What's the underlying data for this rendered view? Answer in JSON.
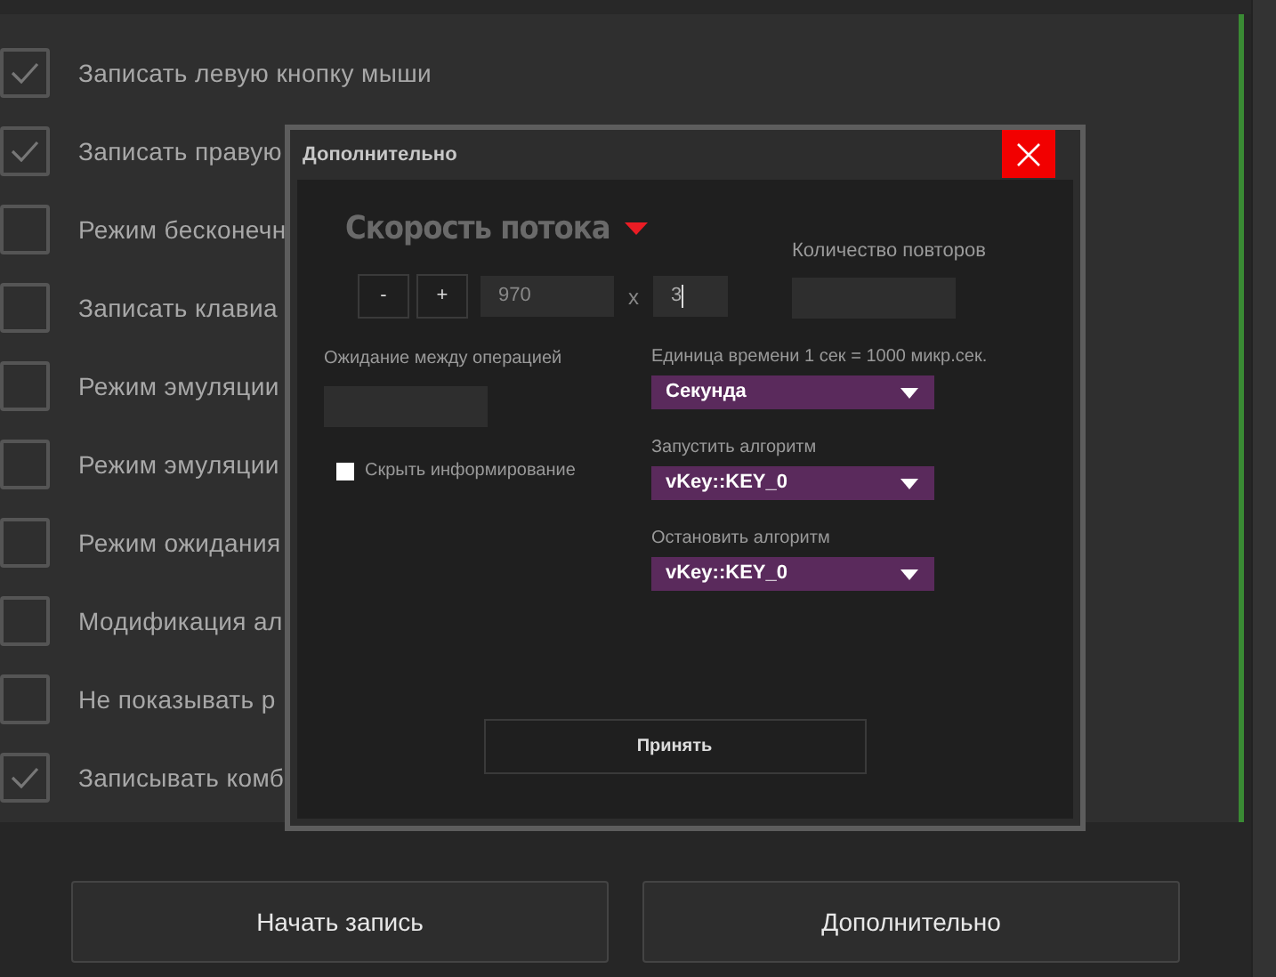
{
  "options": [
    {
      "label": "Записать левую кнопку мыши",
      "checked": true
    },
    {
      "label": "Записать правую",
      "checked": true
    },
    {
      "label": "Режим бесконечн",
      "checked": false
    },
    {
      "label": "Записать клавиа",
      "checked": false
    },
    {
      "label": "Режим эмуляции",
      "checked": false
    },
    {
      "label": "Режим эмуляции",
      "checked": false
    },
    {
      "label": "Режим ожидания",
      "checked": false
    },
    {
      "label": "Модификация ал",
      "checked": false
    },
    {
      "label": "Не показывать р",
      "checked": false
    },
    {
      "label": "Записывать комб",
      "checked": true
    }
  ],
  "buttons": [
    "Начать запись",
    "Дополнительно"
  ],
  "dialog": {
    "title": "Дополнительно",
    "speed_title": "Скорость потока",
    "minus": "-",
    "plus": "+",
    "speed_value": "970",
    "times": "x",
    "multiplier": "3",
    "repeats_label": "Количество повторов",
    "wait_label": "Ожидание между операцией",
    "hide_info": {
      "label": "Скрыть информирование",
      "checked": false
    },
    "selects": [
      {
        "label": "Единица времени 1 сек = 1000 микр.сек.",
        "value": "Секунда"
      },
      {
        "label": "Запустить алгоритм",
        "value": "vKey::KEY_0"
      },
      {
        "label": "Остановить алгоритм",
        "value": "vKey::KEY_0"
      }
    ],
    "accept": "Принять"
  }
}
